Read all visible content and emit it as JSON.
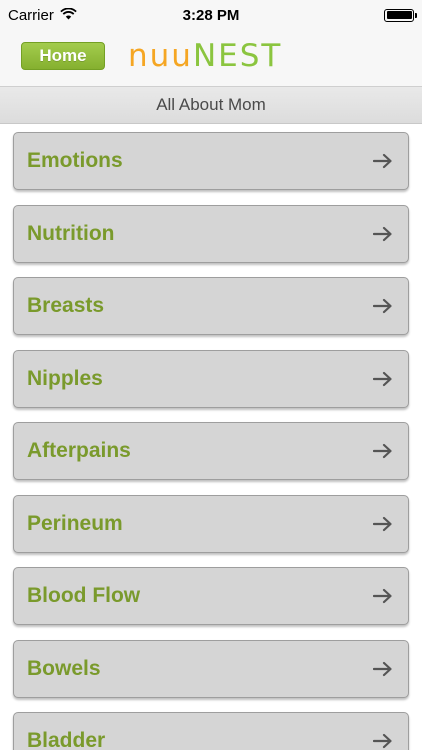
{
  "status_bar": {
    "carrier": "Carrier",
    "time": "3:28 PM",
    "battery_level": 1.0
  },
  "header": {
    "home_label": "Home",
    "logo_part1": "nuu",
    "logo_part2": "NEST"
  },
  "section": {
    "title": "All About Mom"
  },
  "menu": {
    "items": [
      {
        "label": "Emotions"
      },
      {
        "label": "Nutrition"
      },
      {
        "label": "Breasts"
      },
      {
        "label": "Nipples"
      },
      {
        "label": "Afterpains"
      },
      {
        "label": "Perineum"
      },
      {
        "label": "Blood Flow"
      },
      {
        "label": "Bowels"
      },
      {
        "label": "Bladder"
      }
    ],
    "item_icon": "arrow-right-icon"
  },
  "colors": {
    "accent_green": "#8bc53f",
    "logo_orange": "#f5a623",
    "label_green": "#7a9a2c"
  }
}
